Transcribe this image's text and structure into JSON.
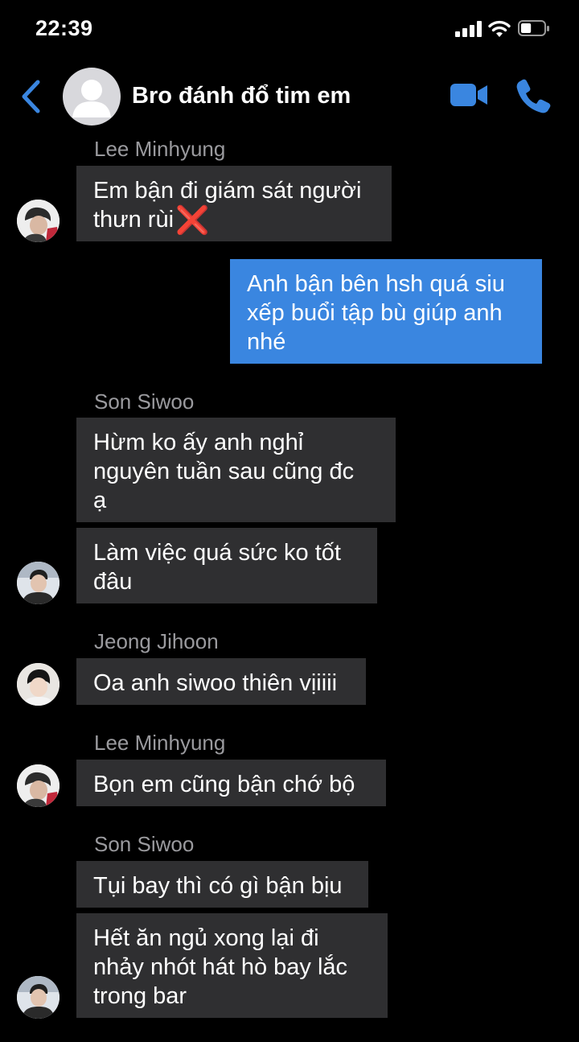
{
  "status_bar": {
    "time": "22:39",
    "battery_level": 0.45
  },
  "header": {
    "title": "Bro đánh đổ tim em",
    "icons": [
      "chevron-left-icon",
      "avatar-placeholder-icon",
      "video-camera-icon",
      "phone-icon"
    ]
  },
  "colors": {
    "outgoing_bubble": "#3a86e0",
    "incoming_bubble": "#2f2f31",
    "accent": "#3a86e0",
    "sender_name": "#9a9a9e",
    "background": "#000000"
  },
  "messages": [
    {
      "sender": "Lee Minhyung",
      "lines": [
        "Em bận đi giám sát người",
        "thưn rùi"
      ],
      "emoji": "❌"
    },
    {
      "sender": "",
      "lines": [
        "Anh bận bên hsh quá siu",
        "xếp buổi tập bù giúp anh",
        "nhé"
      ]
    },
    {
      "sender": "Son Siwoo",
      "lines": [
        "Hừm ko ấy anh nghỉ",
        "nguyên tuần sau cũng đc",
        "ạ"
      ]
    },
    {
      "sender": "",
      "lines": [
        "Làm việc quá sức ko tốt",
        "đâu"
      ]
    },
    {
      "sender": "Jeong Jihoon",
      "lines": [
        "Oa anh siwoo thiên vịiiii"
      ]
    },
    {
      "sender": "Lee Minhyung",
      "lines": [
        "Bọn em cũng bận chớ bộ"
      ]
    },
    {
      "sender": "Son Siwoo",
      "lines": [
        "Tụi bay thì có gì bận bịu"
      ]
    },
    {
      "sender": "",
      "lines": [
        "Hết ăn ngủ xong lại đi",
        "nhảy nhót hát hò bay lắc",
        "trong bar"
      ]
    }
  ]
}
